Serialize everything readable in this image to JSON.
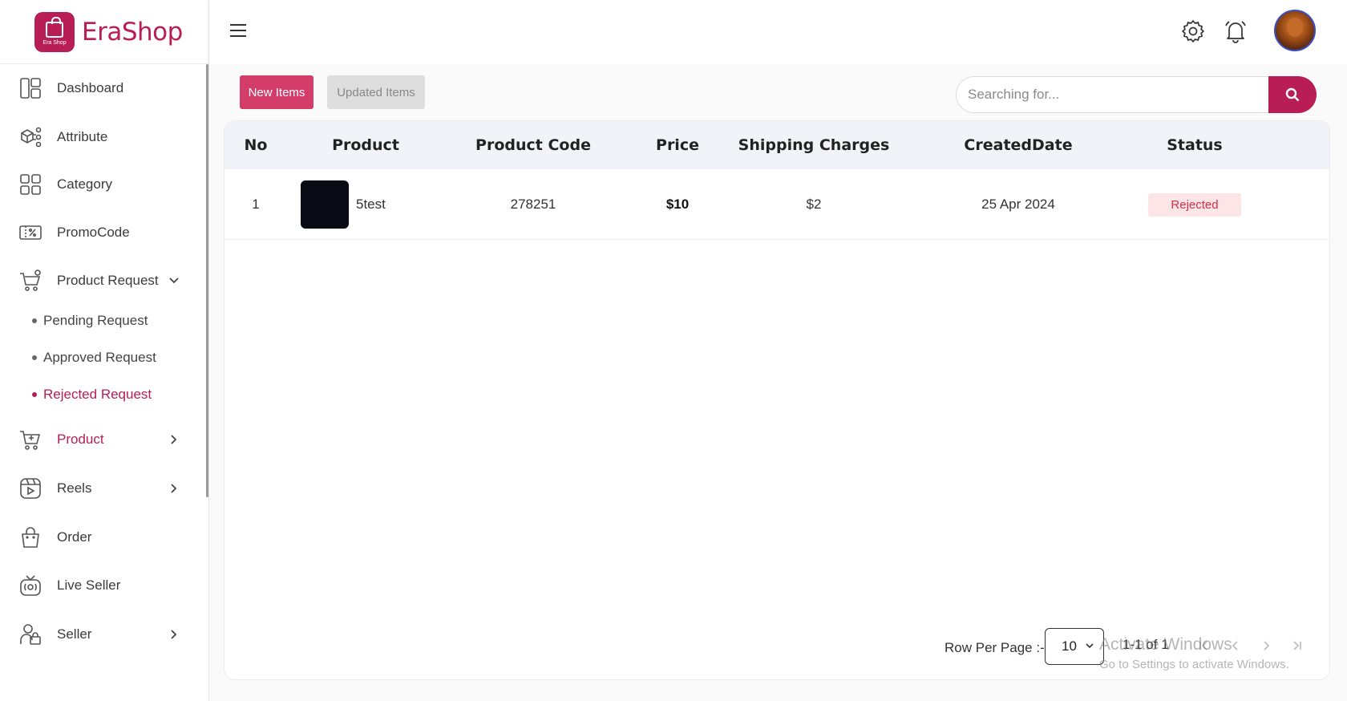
{
  "brand": {
    "name": "EraShop",
    "logo_text": "Era Shop"
  },
  "sidebar": {
    "items": [
      {
        "label": "Dashboard",
        "icon": "dashboard-icon"
      },
      {
        "label": "Attribute",
        "icon": "attribute-icon"
      },
      {
        "label": "Category",
        "icon": "category-icon"
      },
      {
        "label": "PromoCode",
        "icon": "promocode-icon"
      },
      {
        "label": "Product Request",
        "icon": "cart-request-icon",
        "expanded": true
      },
      {
        "label": "Product",
        "icon": "cart-add-icon",
        "active": true
      },
      {
        "label": "Reels",
        "icon": "reels-icon"
      },
      {
        "label": "Order",
        "icon": "bag-icon"
      },
      {
        "label": "Live Seller",
        "icon": "tv-icon"
      },
      {
        "label": "Seller",
        "icon": "seller-icon"
      }
    ],
    "sub_items": [
      {
        "label": "Pending Request"
      },
      {
        "label": "Approved Request"
      },
      {
        "label": "Rejected Request",
        "active": true
      }
    ]
  },
  "header": {
    "menu_icon": "hamburger-icon",
    "settings_icon": "gear-icon",
    "notification_icon": "bell-icon"
  },
  "tabs": {
    "new_items": "New Items",
    "updated_items": "Updated Items"
  },
  "search": {
    "placeholder": "Searching for..."
  },
  "table": {
    "columns": [
      "No",
      "Product",
      "Product Code",
      "Price",
      "Shipping Charges",
      "CreatedDate",
      "Status"
    ],
    "rows": [
      {
        "no": "1",
        "product": "5test",
        "code": "278251",
        "price": "$10",
        "shipping": "$2",
        "created": "25 Apr 2024",
        "status": "Rejected"
      }
    ]
  },
  "pagination": {
    "rows_label": "Row Per Page :-",
    "rows_value": "10",
    "range": "1-1 of 1"
  },
  "watermark": {
    "line1": "Activate Windows",
    "line2": "Go to Settings to activate Windows."
  },
  "colors": {
    "brand": "#b81d55",
    "tab_active": "#d43d6a",
    "rejected_text": "#d0314a",
    "rejected_bg": "#fde4e6"
  }
}
